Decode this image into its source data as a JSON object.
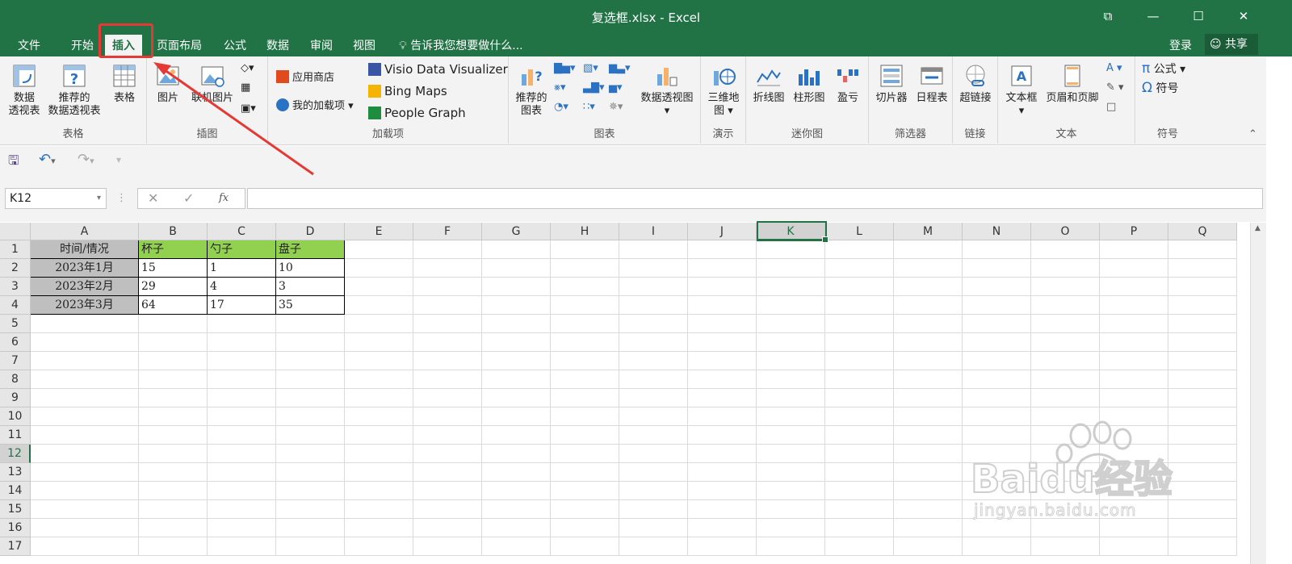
{
  "window": {
    "title": "复选框.xlsx - Excel"
  },
  "tabs": [
    "文件",
    "开始",
    "插入",
    "页面布局",
    "公式",
    "数据",
    "审阅",
    "视图"
  ],
  "active_tab": "插入",
  "tell_me": "告诉我您想要做什么...",
  "account": {
    "login": "登录",
    "share": "共享"
  },
  "ribbon": {
    "tables": {
      "label": "表格",
      "pivot_table": "数据\n透视表",
      "recommended_pivot": "推荐的\n数据透视表",
      "table": "表格"
    },
    "illustrations": {
      "label": "插图",
      "pictures": "图片",
      "online_pictures": "联机图片"
    },
    "addins": {
      "label": "加载项",
      "store": "应用商店",
      "my_addins": "我的加载项",
      "visio": "Visio Data Visualizer",
      "bing_maps": "Bing Maps",
      "people_graph": "People Graph"
    },
    "charts": {
      "label": "图表",
      "recommended_charts": "推荐的\n图表",
      "pivot_chart": "数据透视图"
    },
    "tours": {
      "label": "演示",
      "map3d": "三维地\n图"
    },
    "sparklines": {
      "label": "迷你图",
      "line": "折线图",
      "column": "柱形图",
      "win_loss": "盈亏"
    },
    "filters": {
      "label": "筛选器",
      "slicer": "切片器",
      "timeline": "日程表"
    },
    "links": {
      "label": "链接",
      "hyperlink": "超链接"
    },
    "text": {
      "label": "文本",
      "textbox": "文本框",
      "header_footer": "页眉和页脚"
    },
    "symbols": {
      "label": "符号",
      "equation": "公式",
      "symbol": "符号"
    }
  },
  "formula_bar": {
    "name_box": "K12",
    "fx": "fx",
    "formula": ""
  },
  "columns": [
    "A",
    "B",
    "C",
    "D",
    "E",
    "F",
    "G",
    "H",
    "I",
    "J",
    "K",
    "L",
    "M",
    "N",
    "O",
    "P",
    "Q"
  ],
  "rows": [
    "1",
    "2",
    "3",
    "4",
    "5",
    "6",
    "7",
    "8",
    "9",
    "10",
    "11",
    "12",
    "13",
    "14",
    "15",
    "16",
    "17"
  ],
  "selected_cell": "K12",
  "table": {
    "header": [
      "时间/情况",
      "杯子",
      "勺子",
      "盘子"
    ],
    "rows": [
      [
        "2023年1月",
        "15",
        "1",
        "10"
      ],
      [
        "2023年2月",
        "29",
        "4",
        "3"
      ],
      [
        "2023年3月",
        "64",
        "17",
        "35"
      ]
    ]
  },
  "watermark": {
    "brand": "Baidu经验",
    "url": "jingyan.baidu.com"
  },
  "colors": {
    "excel_green": "#217346",
    "header_fill": "#92d050",
    "label_fill": "#bfbfbf",
    "annotation_red": "#e53935"
  }
}
